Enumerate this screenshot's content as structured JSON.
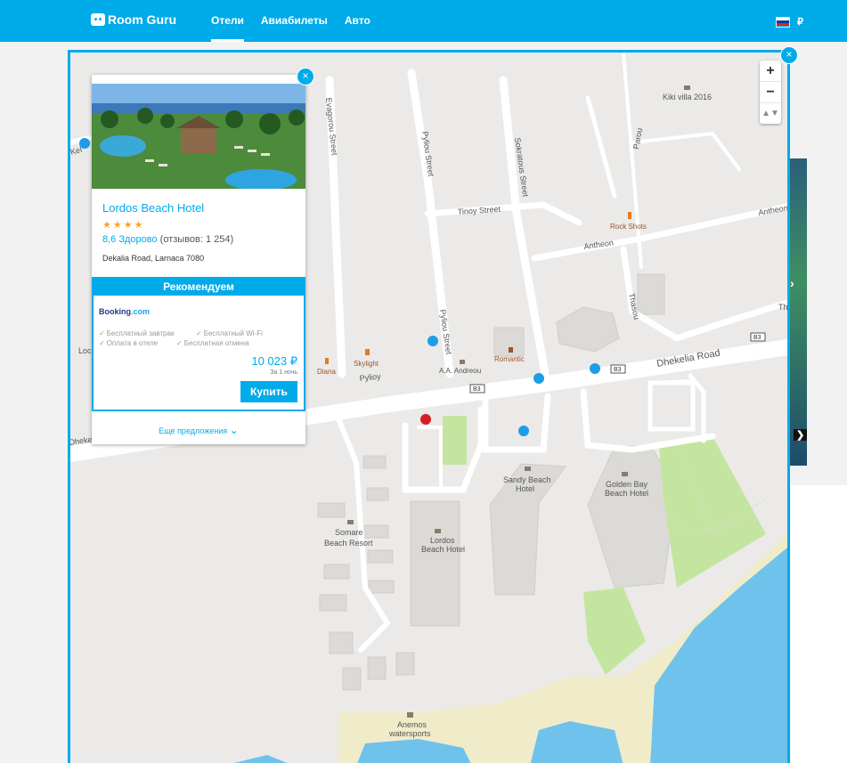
{
  "header": {
    "logo": "Room Guru",
    "nav": [
      {
        "label": "Отели",
        "active": true
      },
      {
        "label": "Авиабилеты",
        "active": false
      },
      {
        "label": "Авто",
        "active": false
      }
    ],
    "currency": "₽",
    "flag_colors": [
      "#ffffff",
      "#0039a6",
      "#d52b1e"
    ]
  },
  "map": {
    "close_icon": "×",
    "zoom_in": "+",
    "zoom_out": "−",
    "compass": "▲▼",
    "labels": {
      "kiki": "Kiki villa 2016",
      "evagorou": "Evagorou Street",
      "pyliou1": "Pyliou Street",
      "sokratous": "Sokratous Street",
      "parou": "Parou",
      "tinoy": "Tinoy Street",
      "rockshots": "Rock Shots",
      "antheon1": "Antheon",
      "antheon2": "Antheon",
      "thasou": "Thasou",
      "pyliou2": "Pyliou Street",
      "romantic": "Romantic",
      "skylight": "Skylight",
      "diana": "Diana",
      "andreou": "A.A. Andreou",
      "pylioy": "Pylioy",
      "dhekelia": "Dhekelia Road",
      "b3a": "B3",
      "b3b": "B3",
      "b3c": "B3",
      "sandy1": "Sandy Beach",
      "sandy2": "Hotel",
      "golden1": "Golden Bay",
      "golden2": "Beach Hotel",
      "somare1": "Somare",
      "somare2": "Beach Resort",
      "lordos1": "Lordos",
      "lordos2": "Beach Hotel",
      "anemos1": "Anemos",
      "anemos2": "watersports",
      "kel": "Kel",
      "loc": "Loc",
      "dheke": "Dheke",
      "th": "Th"
    }
  },
  "card": {
    "close_icon": "×",
    "hotel_name": "Lordos Beach Hotel",
    "stars": "★★★★",
    "rating_score": "8,6 Здорово",
    "rating_reviews": "(отзывов: 1 254)",
    "address": "Dekalia Road, Larnaca 7080",
    "recommend": "Рекомендуем",
    "provider_a": "Booking",
    "provider_b": ".com",
    "check_icon": "✓",
    "features": [
      "Бесплатный завтрак",
      "Бесплатный Wi-Fi",
      "Оплата в отеле",
      "Бесплатная отмена"
    ],
    "price": "10 023 ₽",
    "per_night": "За 1 ночь",
    "buy": "Купить",
    "more": "Еще предложения",
    "more_icon": "⌄"
  },
  "background": {
    "arrow_right": "›",
    "arrow_right2": "❯"
  }
}
